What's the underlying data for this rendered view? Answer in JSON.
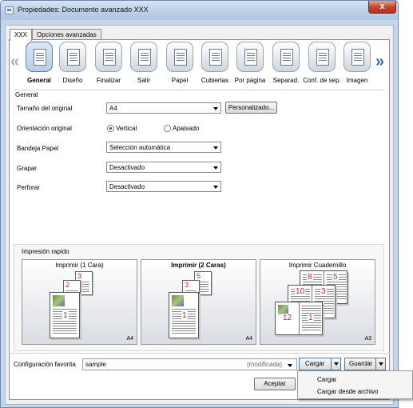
{
  "window": {
    "title": "Propiedades: Documento avanzado XXX",
    "close_glyph": "x"
  },
  "tabs": [
    {
      "label": "XXX",
      "active": true
    },
    {
      "label": "Opciones avanzadas",
      "active": false
    }
  ],
  "categories": [
    {
      "label": "General",
      "icon": "general-icon",
      "selected": true
    },
    {
      "label": "Diseño",
      "icon": "layout-icon"
    },
    {
      "label": "Finalizar",
      "icon": "finishing-icon"
    },
    {
      "label": "Salir",
      "icon": "output-icon"
    },
    {
      "label": "Papel",
      "icon": "paper-icon"
    },
    {
      "label": "Cubiertas",
      "icon": "cover-icon"
    },
    {
      "label": "Por página",
      "icon": "per-page-icon"
    },
    {
      "label": "Separad.",
      "icon": "separator-icon"
    },
    {
      "label": "Conf. de sep.",
      "icon": "separator-settings-icon"
    },
    {
      "label": "Imagen",
      "icon": "image-icon"
    }
  ],
  "nav": {
    "left": "«",
    "right": "»"
  },
  "general": {
    "group_label": "General",
    "original_size": {
      "label": "Tamaño del original",
      "value": "A4",
      "custom_button": "Personalizado..."
    },
    "orientation": {
      "label": "Orientación original",
      "options": [
        {
          "label": "Vertical",
          "selected": true
        },
        {
          "label": "Apaisado",
          "selected": false
        }
      ]
    },
    "paper_tray": {
      "label": "Bandeja Papel",
      "value": "Selección automática"
    },
    "staple": {
      "label": "Grapar",
      "value": "Desactivado"
    },
    "punch": {
      "label": "Perforar",
      "value": "Desactivado"
    }
  },
  "quick_print": {
    "label": "Impresión rapido",
    "cards": [
      {
        "title": "Imprimir (1 Cara)",
        "size": "A4",
        "selected": false,
        "pages": [
          "3",
          "2",
          "1"
        ]
      },
      {
        "title": "Imprimir (2 Caras)",
        "size": "A4",
        "selected": true,
        "pages": [
          "5",
          "3",
          "1"
        ]
      },
      {
        "title": "Imprimir Cuadernillo",
        "size": "A3",
        "selected": false,
        "spreads": [
          [
            "8",
            "5"
          ],
          [
            "10",
            "3"
          ],
          [
            "12",
            "1"
          ]
        ]
      }
    ]
  },
  "favorites": {
    "label": "Configuración favorita",
    "value": "sample",
    "modified": "(modificada)",
    "load_button": "Cargar",
    "save_button": "Guardar",
    "accept_button": "Aceptar"
  },
  "load_menu": {
    "items": [
      "Cargar",
      "Cargar desde archivo"
    ]
  }
}
